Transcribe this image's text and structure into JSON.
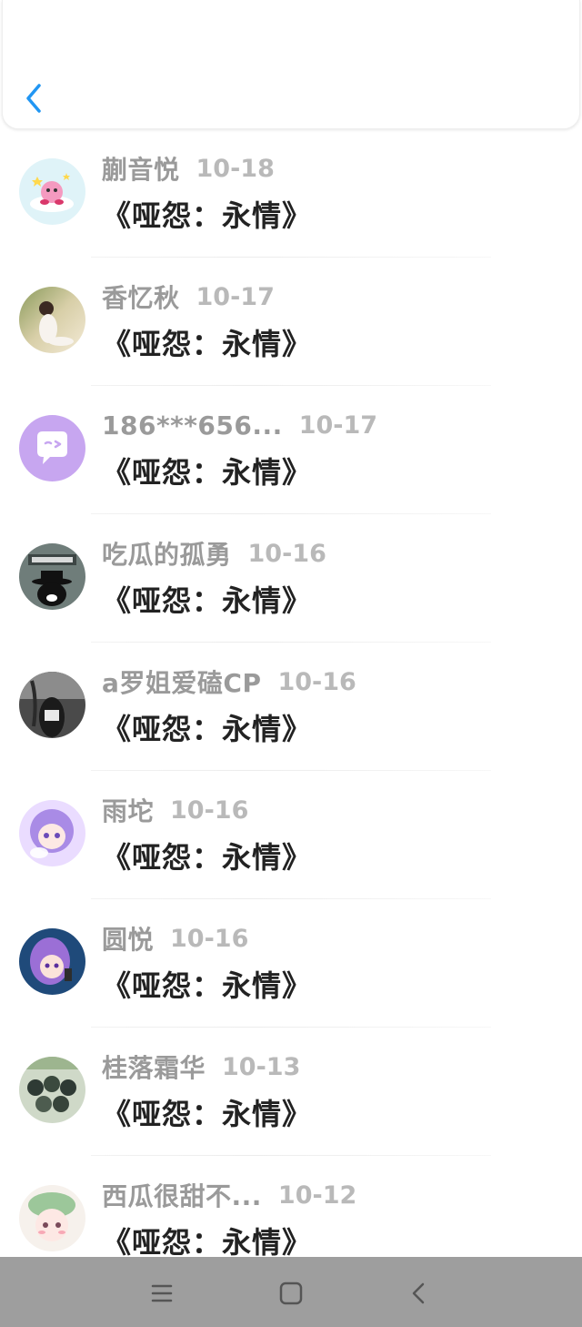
{
  "header": {
    "back_icon": "chevron-left-icon",
    "accent_color": "#2196f3"
  },
  "items": [
    {
      "name": "蒯音悦",
      "date": "10-18",
      "title": "《哑怨：永情》",
      "avatar": "kirby-cloud-avatar"
    },
    {
      "name": "香忆秋",
      "date": "10-17",
      "title": "《哑怨：永情》",
      "avatar": "girl-photo-avatar"
    },
    {
      "name": "186***656...",
      "date": "10-17",
      "title": "《哑怨：永情》",
      "avatar": "purple-chat-bubble-avatar"
    },
    {
      "name": "吃瓜的孤勇",
      "date": "10-16",
      "title": "《哑怨：永情》",
      "avatar": "black-cat-hat-avatar"
    },
    {
      "name": "a罗姐爱磕CP",
      "date": "10-16",
      "title": "《哑怨：永情》",
      "avatar": "dark-photo-avatar"
    },
    {
      "name": "雨坨",
      "date": "10-16",
      "title": "《哑怨：永情》",
      "avatar": "anime-purple-girl-avatar"
    },
    {
      "name": "圆悦",
      "date": "10-16",
      "title": "《哑怨：永情》",
      "avatar": "anime-violet-hair-avatar"
    },
    {
      "name": "桂落霜华",
      "date": "10-13",
      "title": "《哑怨：永情》",
      "avatar": "group-photo-avatar"
    },
    {
      "name": "西瓜很甜不...",
      "date": "10-12",
      "title": "《哑怨：永情》",
      "avatar": "anime-green-hat-avatar"
    }
  ],
  "navbar": {
    "menu_icon": "menu-icon",
    "home_icon": "home-square-icon",
    "back_icon": "back-chevron-icon"
  }
}
